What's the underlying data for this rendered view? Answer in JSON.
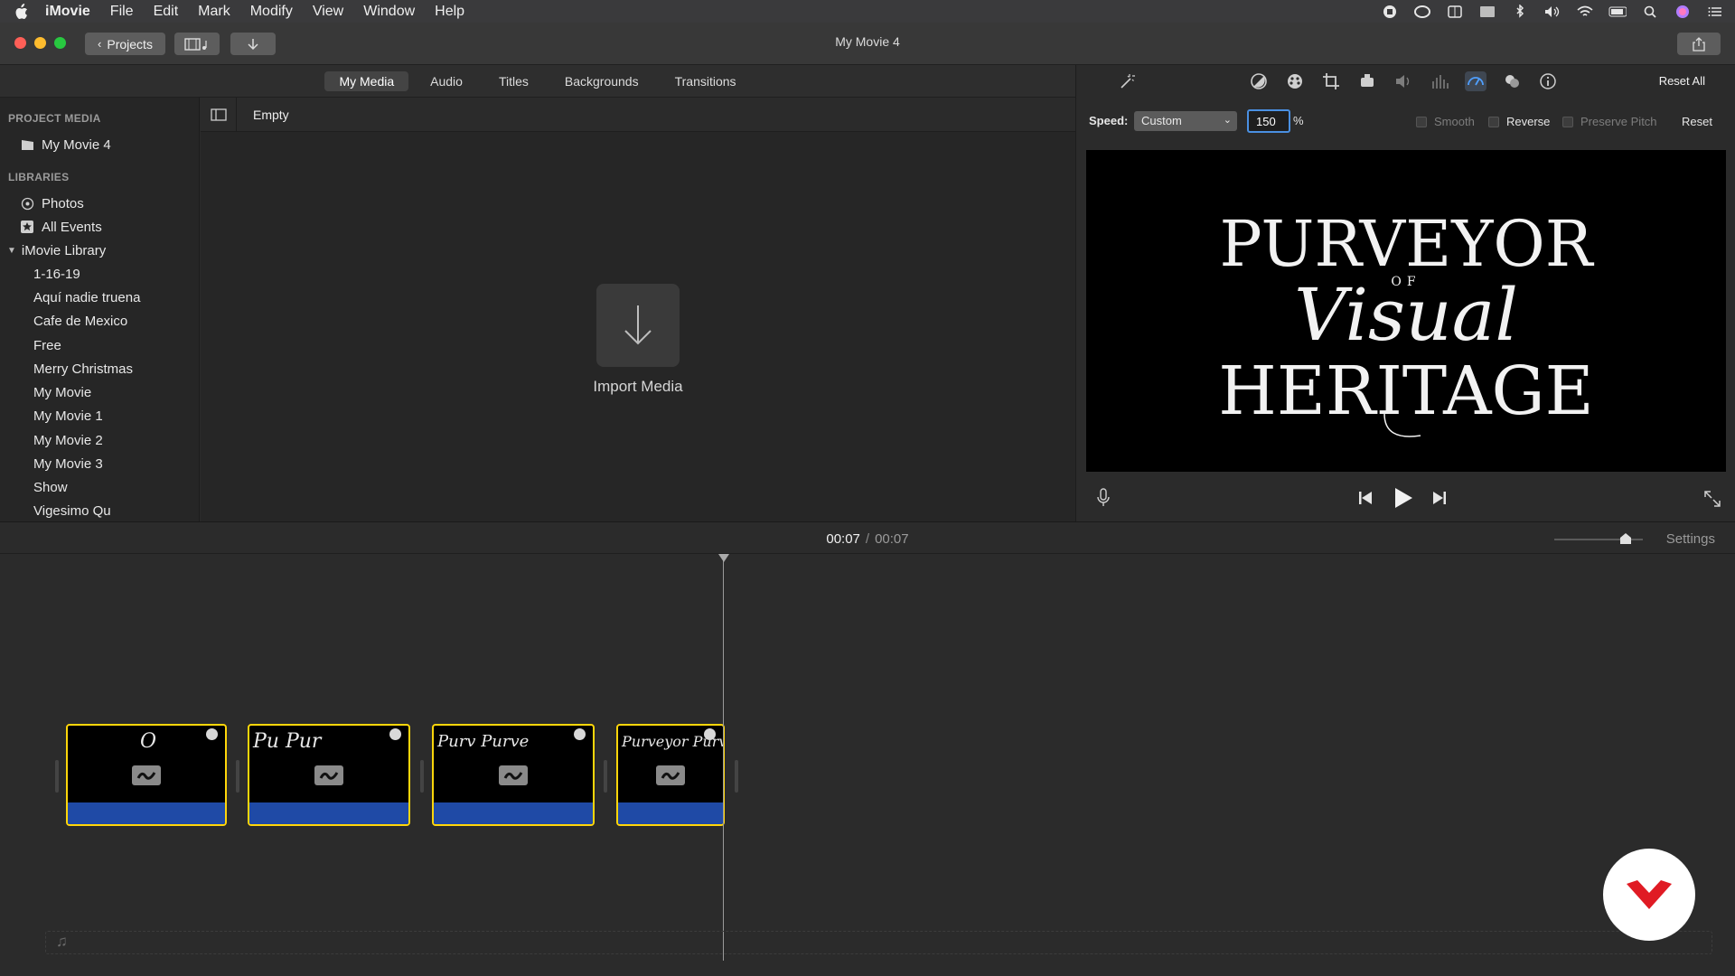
{
  "menubar": {
    "items": [
      "iMovie",
      "File",
      "Edit",
      "Mark",
      "Modify",
      "View",
      "Window",
      "Help"
    ]
  },
  "toolbar": {
    "projects_label": "Projects",
    "window_title": "My Movie 4"
  },
  "browser": {
    "tabs": [
      "My Media",
      "Audio",
      "Titles",
      "Backgrounds",
      "Transitions"
    ],
    "active_tab": "My Media",
    "header_label": "Empty",
    "import_label": "Import Media"
  },
  "sidebar": {
    "project_media_heading": "PROJECT MEDIA",
    "project_item": "My Movie 4",
    "libraries_heading": "LIBRARIES",
    "photos": "Photos",
    "all_events": "All Events",
    "library_name": "iMovie Library",
    "events": [
      "1-16-19",
      "Aquí nadie truena",
      "Cafe de Mexico",
      "Free",
      "Merry Christmas",
      "My Movie",
      "My Movie 1",
      "My Movie 2",
      "My Movie 3",
      "Show",
      "Vigesimo Qu"
    ]
  },
  "inspector": {
    "reset_all": "Reset All",
    "speed_label": "Speed:",
    "speed_mode": "Custom",
    "speed_value": "150",
    "percent": "%",
    "smooth": "Smooth",
    "reverse": "Reverse",
    "preserve_pitch": "Preserve Pitch",
    "reset": "Reset",
    "active_tool": "speed-icon"
  },
  "preview": {
    "line1": "PURVEYOR",
    "line2": "OF",
    "line3": "Visual",
    "line4": "HERITAGE"
  },
  "timeline": {
    "current_time": "00:07",
    "separator": "/",
    "total_time": "00:07",
    "settings_label": "Settings",
    "clips": [
      {
        "text": "  O"
      },
      {
        "text": "Pu   Pur"
      },
      {
        "text": "Purv  Purve"
      },
      {
        "text": "Purveyor Purv"
      }
    ]
  },
  "colors": {
    "accent": "#4a90e2",
    "clip_selected": "#ffd60a",
    "clip_audio": "#1f4aa6",
    "watermark": "#e01b24"
  }
}
